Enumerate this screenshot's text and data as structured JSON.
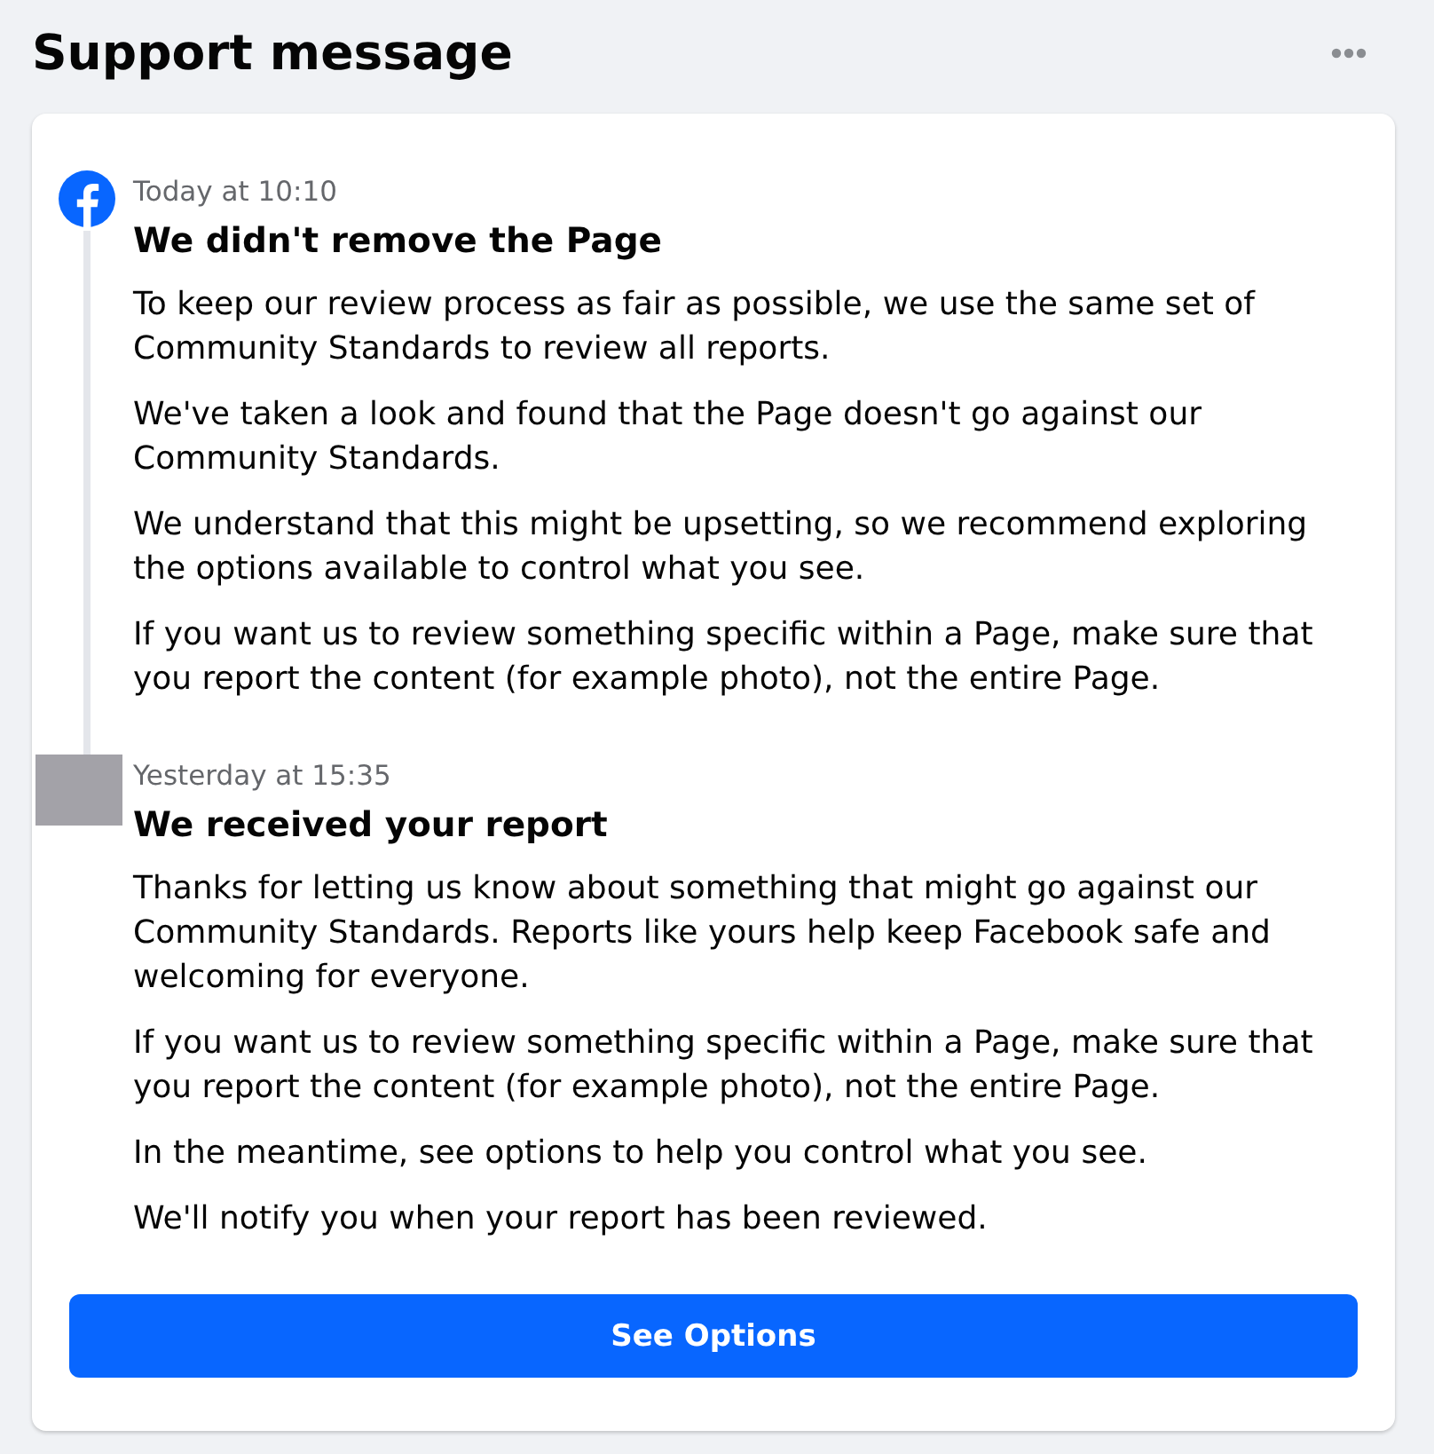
{
  "header": {
    "title": "Support message"
  },
  "messages": [
    {
      "kind": "logo",
      "time": "Today at 10:10",
      "title": "We didn't remove the Page",
      "paragraphs": [
        "To keep our review process as fair as possible, we use the same set of Community Standards to review all reports.",
        "We've taken a look and found that the Page doesn't go against our Community Standards.",
        "We understand that this might be upsetting, so we recommend exploring the options available to control what you see.",
        "If you want us to review something specific within a Page, make sure that you report the content (for example photo), not the entire Page."
      ]
    },
    {
      "kind": "image",
      "time": "Yesterday at 15:35",
      "title": "We received your report",
      "paragraphs": [
        "Thanks for letting us know about something that might go against our Community Standards. Reports like yours help keep Facebook safe and welcoming for everyone.",
        "If you want us to review something specific within a Page, make sure that you report the content (for example photo), not the entire Page.",
        "In the meantime, see options to help you control what you see.",
        "We'll notify you when your report has been reviewed."
      ]
    }
  ],
  "button": {
    "label": "See Options"
  }
}
